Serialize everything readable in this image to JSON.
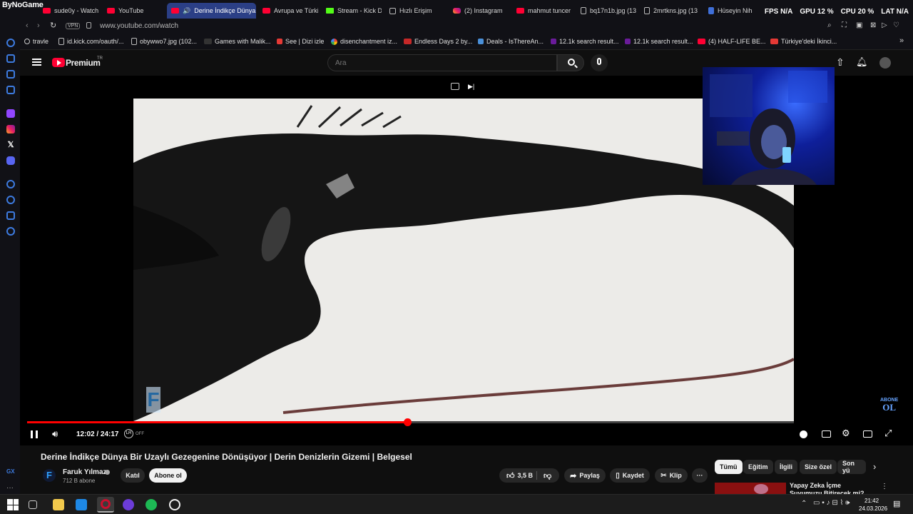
{
  "browser": {
    "logo_text": "ByNoGame",
    "tabs": [
      {
        "label": "sude0y - Watch",
        "icon": "youtube-icon"
      },
      {
        "label": "YouTube",
        "icon": "youtube-icon"
      },
      {
        "label": "Derine İndikçe Dünya",
        "icon": "youtube-icon",
        "active": true
      },
      {
        "label": "Avrupa ve Türki",
        "icon": "youtube-icon"
      },
      {
        "label": "Stream - Kick D",
        "icon": "kick-icon"
      },
      {
        "label": "Hızlı Erişim",
        "icon": "grid-icon"
      },
      {
        "label": "(2) Instagram",
        "icon": "instagram-icon"
      },
      {
        "label": "mahmut tuncer",
        "icon": "youtube-icon"
      },
      {
        "label": "bq17n1b.jpg (13",
        "icon": "document-icon"
      },
      {
        "label": "2mrtkns.jpg (13",
        "icon": "document-icon"
      },
      {
        "label": "Hüseyin Nihal",
        "icon": "pin-icon"
      }
    ],
    "stats": {
      "fps": "FPS N/A",
      "gpu": "GPU 12 %",
      "cpu": "CPU 20 %",
      "lat": "LAT N/A"
    },
    "url": "www.youtube.com/watch",
    "vpn": "VPN",
    "bookmarks": [
      "travle",
      "id.kick.com/oauth/...",
      "obywwo7.jpg (102...",
      "Games with Malik...",
      "See | Dizi izle",
      "disenchantment iz...",
      "Endless Days 2 by...",
      "Deals - IsThereAn...",
      "12.1k search result...",
      "12.1k search result...",
      "(4) HALF-LIFE BE...",
      "Türkiye'deki İkinci..."
    ]
  },
  "youtube": {
    "logo": "Premium",
    "region": "TR",
    "search_placeholder": "Ara",
    "video": {
      "time": "12:02 / 24:17",
      "progress": 0.4958,
      "overlay_text": "ABONE\nOL",
      "autoplay_label": "OFF",
      "title": "Derine İndikçe Dünya Bir Uzaylı Gezegenine Dönüşüyor | Derin Denizlerin Gizemi | Belgesel"
    },
    "channel": {
      "name": "Faruk Yılmaz",
      "subscribers": "712 B abone",
      "join": "Katıl",
      "subscribe": "Abone ol"
    },
    "actions": {
      "likes": "3,5 B",
      "share": "Paylaş",
      "save": "Kaydet",
      "clip": "Klip"
    },
    "chips": [
      "Tümü",
      "Eğitim",
      "İlgili",
      "Size özel",
      "Son yü"
    ],
    "recommendation": {
      "title": "Yapay Zeka İçme Suyumuzu Bitirecek mi?"
    }
  },
  "taskbar": {
    "time": "21:42",
    "date": "24.03.2026"
  }
}
